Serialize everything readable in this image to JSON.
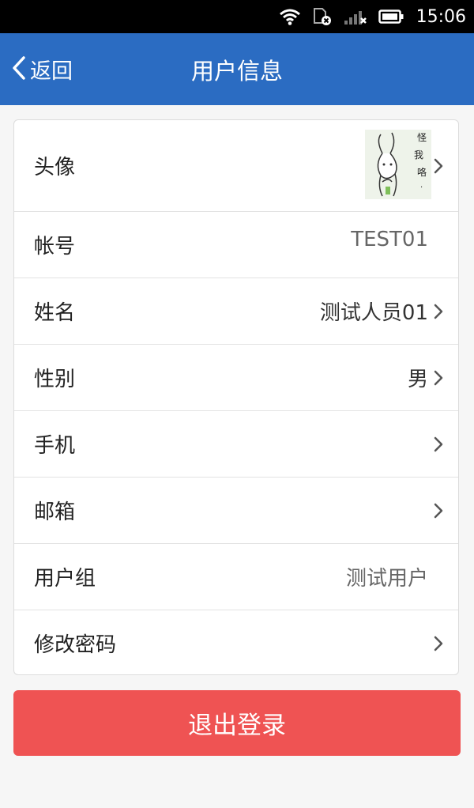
{
  "status_bar": {
    "time": "15:06",
    "icons": [
      "wifi-icon",
      "sim-disabled-icon",
      "signal-off-icon",
      "battery-icon"
    ]
  },
  "header": {
    "back_label": "返回",
    "title": "用户信息",
    "background": "#2b6cc2"
  },
  "profile": {
    "rows": [
      {
        "label": "头像",
        "value": "",
        "chevron": true,
        "avatar_text": [
          "怪",
          "我",
          "咯",
          "·"
        ]
      },
      {
        "label": "帐号",
        "value": "TEST01",
        "chevron": false
      },
      {
        "label": "姓名",
        "value": "测试人员01",
        "chevron": true
      },
      {
        "label": "性别",
        "value": "男",
        "chevron": true
      },
      {
        "label": "手机",
        "value": "",
        "chevron": true
      },
      {
        "label": "邮箱",
        "value": "",
        "chevron": true
      },
      {
        "label": "用户组",
        "value": "测试用户",
        "chevron": false
      },
      {
        "label": "修改密码",
        "value": "",
        "chevron": true
      }
    ]
  },
  "logout": {
    "label": "退出登录",
    "color": "#ef5353"
  }
}
